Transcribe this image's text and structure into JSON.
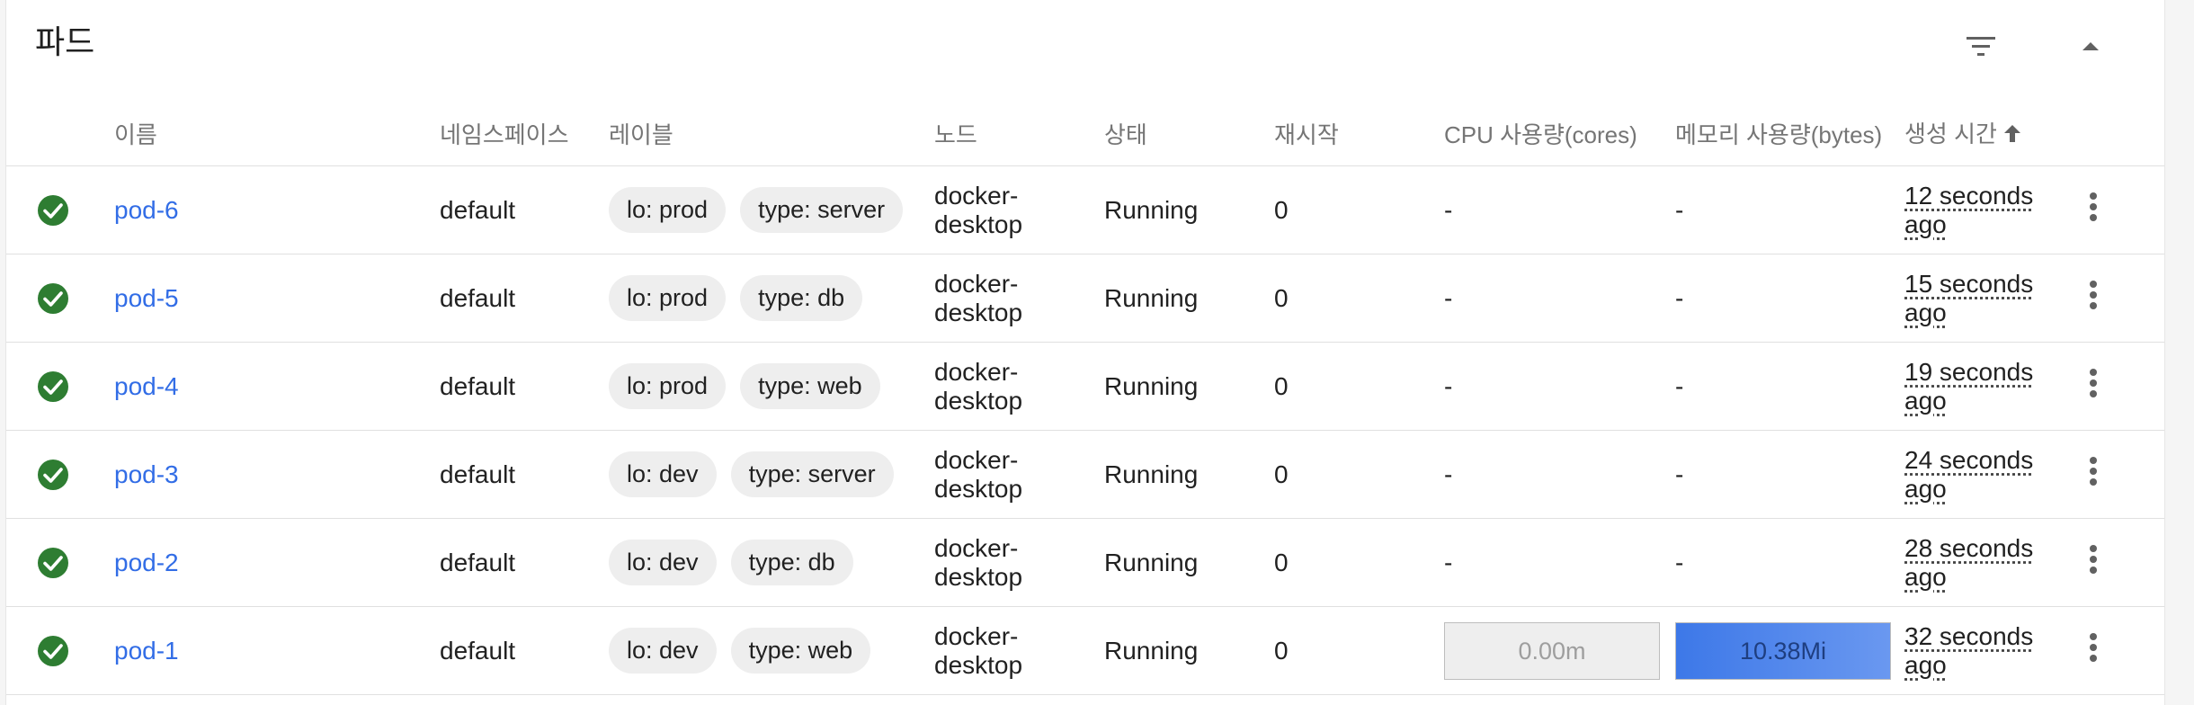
{
  "card": {
    "title": "파드"
  },
  "colors": {
    "link": "#326de6",
    "status_ok": "#2e7d32",
    "cpu_bar_bg": "#eeeeee",
    "mem_bar_fill": "#4a80ea"
  },
  "icons": {
    "filter": "filter-icon",
    "collapse": "chevron-up-icon",
    "status": "check-circle-icon",
    "menu": "more-vert-icon",
    "sort": "arrow-up-icon"
  },
  "columns": {
    "name": "이름",
    "namespace": "네임스페이스",
    "labels": "레이블",
    "node": "노드",
    "status": "상태",
    "restarts": "재시작",
    "cpu": "CPU 사용량(cores)",
    "memory": "메모리 사용량(bytes)",
    "created": "생성 시간"
  },
  "rows": [
    {
      "name": "pod-6",
      "namespace": "default",
      "label1": "lo: prod",
      "label2": "type: server",
      "node_line1": "docker-",
      "node_line2": "desktop",
      "status": "Running",
      "restarts": "0",
      "cpu": "-",
      "memory": "-",
      "created_line1": "12 seconds",
      "created_line2": "ago"
    },
    {
      "name": "pod-5",
      "namespace": "default",
      "label1": "lo: prod",
      "label2": "type: db",
      "node_line1": "docker-",
      "node_line2": "desktop",
      "status": "Running",
      "restarts": "0",
      "cpu": "-",
      "memory": "-",
      "created_line1": "15 seconds",
      "created_line2": "ago"
    },
    {
      "name": "pod-4",
      "namespace": "default",
      "label1": "lo: prod",
      "label2": "type: web",
      "node_line1": "docker-",
      "node_line2": "desktop",
      "status": "Running",
      "restarts": "0",
      "cpu": "-",
      "memory": "-",
      "created_line1": "19 seconds",
      "created_line2": "ago"
    },
    {
      "name": "pod-3",
      "namespace": "default",
      "label1": "lo: dev",
      "label2": "type: server",
      "node_line1": "docker-",
      "node_line2": "desktop",
      "status": "Running",
      "restarts": "0",
      "cpu": "-",
      "memory": "-",
      "created_line1": "24 seconds",
      "created_line2": "ago"
    },
    {
      "name": "pod-2",
      "namespace": "default",
      "label1": "lo: dev",
      "label2": "type: db",
      "node_line1": "docker-",
      "node_line2": "desktop",
      "status": "Running",
      "restarts": "0",
      "cpu": "-",
      "memory": "-",
      "created_line1": "28 seconds",
      "created_line2": "ago"
    },
    {
      "name": "pod-1",
      "namespace": "default",
      "label1": "lo: dev",
      "label2": "type: web",
      "node_line1": "docker-",
      "node_line2": "desktop",
      "status": "Running",
      "restarts": "0",
      "cpu": "0.00m",
      "memory": "10.38Mi",
      "created_line1": "32 seconds",
      "created_line2": "ago"
    }
  ]
}
